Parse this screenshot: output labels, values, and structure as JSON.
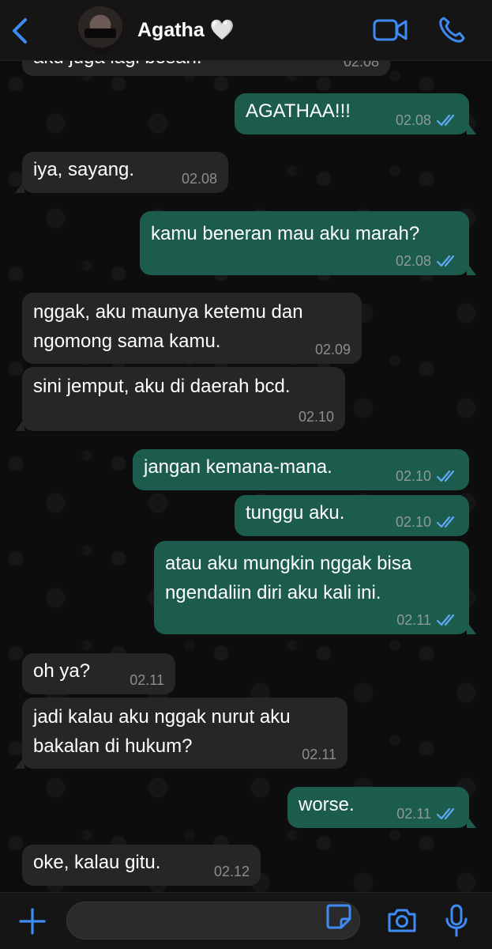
{
  "header": {
    "contact_name": "Agatha 🤍"
  },
  "messages": [
    {
      "dir": "in",
      "text": "aku juga lagi bosan.",
      "time": "02.08"
    },
    {
      "dir": "out",
      "text": "AGATHAA!!!",
      "time": "02.08"
    },
    {
      "dir": "in",
      "text": "iya, sayang.",
      "time": "02.08"
    },
    {
      "dir": "out",
      "text": "kamu beneran mau aku marah?",
      "time": "02.08"
    },
    {
      "dir": "in",
      "text": "nggak, aku maunya ketemu dan\nngomong sama kamu.",
      "time": "02.09"
    },
    {
      "dir": "in",
      "text": "sini jemput, aku di daerah bcd.",
      "time": "02.10"
    },
    {
      "dir": "out",
      "text": "jangan kemana-mana.",
      "time": "02.10"
    },
    {
      "dir": "out",
      "text": "tunggu aku.",
      "time": "02.10"
    },
    {
      "dir": "out",
      "text": "atau aku mungkin nggak bisa\nngendaliin diri aku kali ini.",
      "time": "02.11"
    },
    {
      "dir": "in",
      "text": "oh ya?",
      "time": "02.11"
    },
    {
      "dir": "in",
      "text": "jadi kalau aku nggak nurut aku\nbakalan di hukum?",
      "time": "02.11"
    },
    {
      "dir": "out",
      "text": "worse.",
      "time": "02.11"
    },
    {
      "dir": "in",
      "text": "oke, kalau gitu.",
      "time": "02.12"
    }
  ],
  "colors": {
    "accent": "#3e8bf5",
    "outgoing_bubble": "#1c5c4c",
    "incoming_bubble": "#262626",
    "read_check": "#5fa8f5"
  },
  "icons": {
    "back": "chevron-left-icon",
    "video": "video-camera-icon",
    "phone": "phone-icon",
    "plus": "plus-icon",
    "sticker": "sticker-icon",
    "camera": "camera-icon",
    "mic": "microphone-icon",
    "read": "double-check-icon"
  }
}
